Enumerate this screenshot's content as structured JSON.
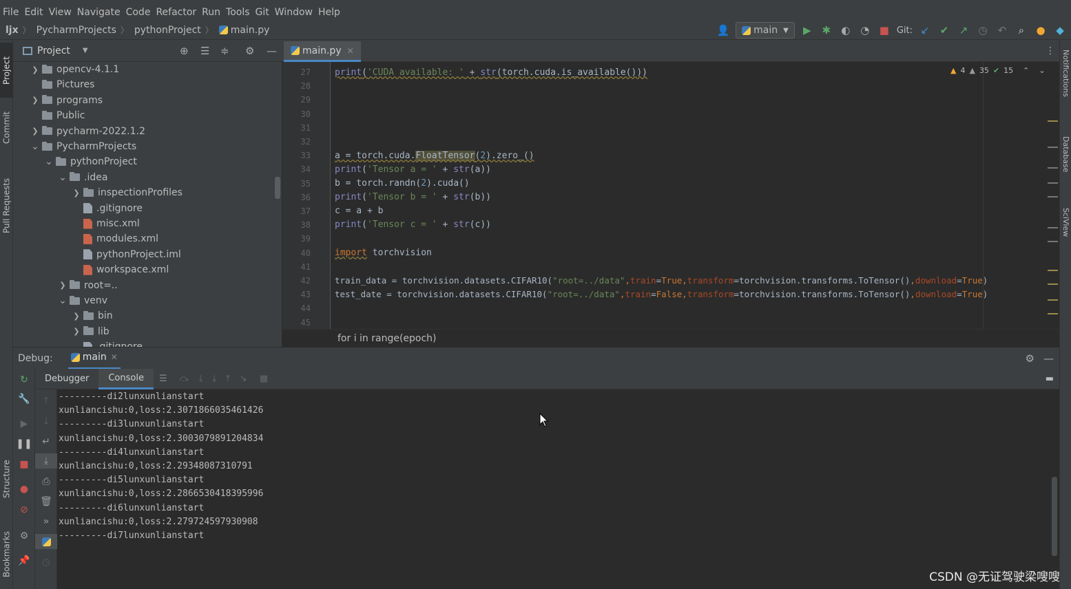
{
  "menubar": [
    "File",
    "Edit",
    "View",
    "Navigate",
    "Code",
    "Refactor",
    "Run",
    "Tools",
    "Git",
    "Window",
    "Help"
  ],
  "breadcrumbs": [
    "ljx",
    "PycharmProjects",
    "pythonProject",
    "main.py"
  ],
  "toolbar": {
    "run_config": "main",
    "git_label": "Git:"
  },
  "left_strip": [
    "Project",
    "Commit",
    "Pull Requests",
    "Structure",
    "Bookmarks"
  ],
  "right_strip": [
    "Notifications",
    "Database",
    "SciView"
  ],
  "project_panel": {
    "title": "Project",
    "tree": [
      {
        "label": "opencv-4.1.1",
        "type": "folder",
        "depth": 0,
        "arrow": "right"
      },
      {
        "label": "Pictures",
        "type": "folder",
        "depth": 0,
        "arrow": ""
      },
      {
        "label": "programs",
        "type": "folder",
        "depth": 0,
        "arrow": "right"
      },
      {
        "label": "Public",
        "type": "folder",
        "depth": 0,
        "arrow": ""
      },
      {
        "label": "pycharm-2022.1.2",
        "type": "folder",
        "depth": 0,
        "arrow": "right"
      },
      {
        "label": "PycharmProjects",
        "type": "folder",
        "depth": 0,
        "arrow": "down"
      },
      {
        "label": "pythonProject",
        "type": "folder",
        "depth": 1,
        "arrow": "down"
      },
      {
        "label": ".idea",
        "type": "folder",
        "depth": 2,
        "arrow": "down"
      },
      {
        "label": "inspectionProfiles",
        "type": "folder",
        "depth": 3,
        "arrow": "right"
      },
      {
        "label": ".gitignore",
        "type": "file",
        "depth": 3,
        "arrow": ""
      },
      {
        "label": "misc.xml",
        "type": "xml",
        "depth": 3,
        "arrow": ""
      },
      {
        "label": "modules.xml",
        "type": "xml",
        "depth": 3,
        "arrow": ""
      },
      {
        "label": "pythonProject.iml",
        "type": "file",
        "depth": 3,
        "arrow": ""
      },
      {
        "label": "workspace.xml",
        "type": "xml",
        "depth": 3,
        "arrow": ""
      },
      {
        "label": "root=..",
        "type": "folder",
        "depth": 2,
        "arrow": "right"
      },
      {
        "label": "venv",
        "type": "folder",
        "depth": 2,
        "arrow": "down"
      },
      {
        "label": "bin",
        "type": "folder",
        "depth": 3,
        "arrow": "right"
      },
      {
        "label": "lib",
        "type": "folder",
        "depth": 3,
        "arrow": "right"
      },
      {
        "label": ".gitignore",
        "type": "file",
        "depth": 3,
        "arrow": ""
      }
    ]
  },
  "editor": {
    "tab": "main.py",
    "inspections": {
      "warnings": "4",
      "weak_warnings": "35",
      "ok": "15"
    },
    "line_numbers": [
      "27",
      "28",
      "29",
      "30",
      "31",
      "32",
      "33",
      "34",
      "35",
      "36",
      "37",
      "38",
      "39",
      "40",
      "41",
      "42",
      "43",
      "44",
      "45"
    ],
    "breadcrumb": "for i in range(epoch)"
  },
  "debug": {
    "label": "Debug:",
    "session": "main",
    "tabs": [
      "Debugger",
      "Console"
    ],
    "console_lines": [
      "---------di2lunxunlianstart",
      "xunliancishu:0,loss:2.3071866035461426",
      "---------di3lunxunlianstart",
      "xunliancishu:0,loss:2.3003079891204834",
      "---------di4lunxunlianstart",
      "xunliancishu:0,loss:2.29348087310791",
      "---------di5lunxunlianstart",
      "xunliancishu:0,loss:2.2866530418395996",
      "---------di6lunxunlianstart",
      "xunliancishu:0,loss:2.279724597930908",
      "---------di7lunxunlianstart"
    ]
  },
  "watermark": "CSDN @无证驾驶梁嗖嗖"
}
